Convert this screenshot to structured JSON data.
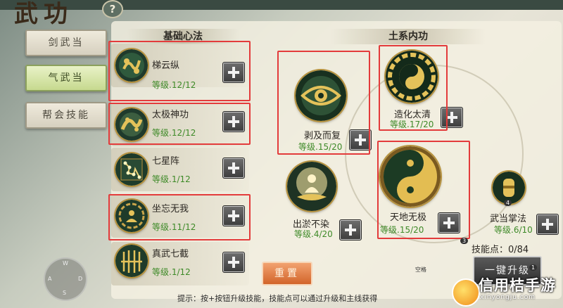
{
  "title_art": "武功",
  "help_label": "?",
  "tabs": [
    {
      "label": "剑武当",
      "active": false
    },
    {
      "label": "气武当",
      "active": true
    },
    {
      "label": "帮会技能",
      "active": false
    }
  ],
  "basic_section": {
    "title": "基础心法",
    "skills": [
      {
        "name": "梯云纵",
        "level": "等级.12/12",
        "icon": "cloud-steps-icon",
        "highlighted": true
      },
      {
        "name": "太极神功",
        "level": "等级.12/12",
        "icon": "taiji-fish-icon",
        "highlighted": true
      },
      {
        "name": "七星阵",
        "level": "等级.1/12",
        "icon": "seven-stars-icon",
        "highlighted": false
      },
      {
        "name": "坐忘无我",
        "level": "等级.11/12",
        "icon": "bagua-meditation-icon",
        "highlighted": true
      },
      {
        "name": "真武七截",
        "level": "等级.1/12",
        "icon": "golden-cage-icon",
        "highlighted": false
      }
    ]
  },
  "earth_section": {
    "title": "土系内功",
    "skills": [
      {
        "id": "bojifu",
        "name": "剥及而复",
        "level": "等级.15/20",
        "icon": "golden-eye-icon",
        "highlighted": true
      },
      {
        "id": "zaohua",
        "name": "造化太清",
        "level": "等级.17/20",
        "icon": "bagua-yinyang-icon",
        "highlighted": true
      },
      {
        "id": "chuyu",
        "name": "出淤不染",
        "level": "等级.4/20",
        "icon": "lotus-sage-icon",
        "highlighted": false
      },
      {
        "id": "tiandi",
        "name": "天地无极",
        "level": "等级.15/20",
        "icon": "large-yinyang-icon",
        "highlighted": true
      },
      {
        "id": "zhangfa",
        "name": "武当掌法",
        "level": "等级.6/10",
        "icon": "golden-gauntlet-icon",
        "highlighted": false
      }
    ]
  },
  "skill_points": "技能点：0/84",
  "reset_label": "重置",
  "upgrade_label": "一键升级",
  "hint": "提示：按+按钮升级技能，技能点可以通过升级和主线获得",
  "small_badge_1": "3",
  "small_badge_2": "4",
  "small_badge_3": "1",
  "small_label_kong": "空格",
  "joystick": {
    "n": "W",
    "w": "A",
    "e": "D",
    "s": "S"
  },
  "watermark": {
    "text": "信用桔手游",
    "sub": "xinyongju.com"
  },
  "colors": {
    "level_green": "#3e8a28",
    "highlight_red": "#e33b3b",
    "reset_orange": "#d2652a"
  }
}
